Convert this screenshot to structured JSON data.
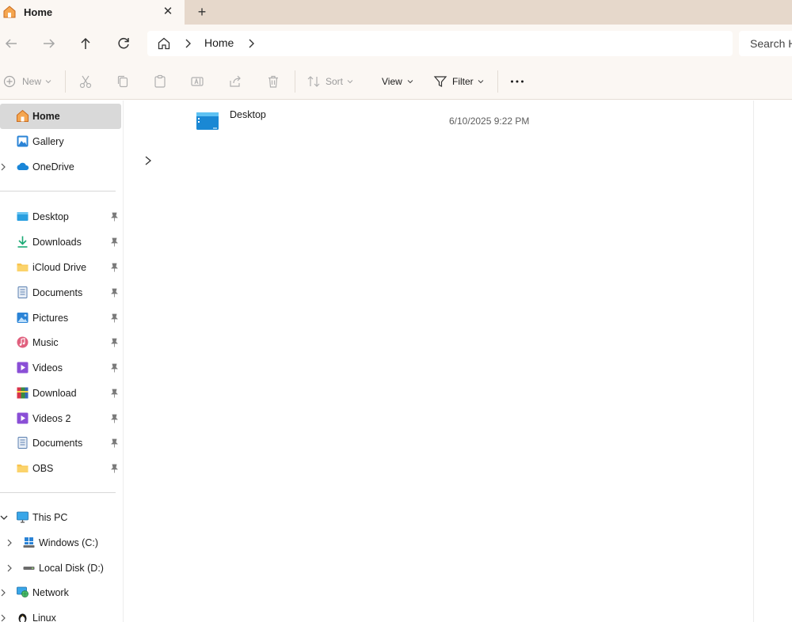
{
  "tab": {
    "title": "Home",
    "close_glyph": "✕",
    "new_glyph": "+"
  },
  "address": {
    "location": "Home",
    "search_placeholder": "Search H"
  },
  "toolbar": {
    "new_label": "New",
    "sort_label": "Sort",
    "view_label": "View",
    "filter_label": "Filter"
  },
  "sidebar": {
    "top": [
      {
        "label": "Home",
        "icon": "home-icon"
      },
      {
        "label": "Gallery",
        "icon": "gallery-icon"
      },
      {
        "label": "OneDrive",
        "icon": "cloud-icon"
      }
    ],
    "pinned": [
      {
        "label": "Desktop",
        "icon": "desktop-folder-icon"
      },
      {
        "label": "Downloads",
        "icon": "download-arrow-icon"
      },
      {
        "label": "iCloud Drive",
        "icon": "folder-icon"
      },
      {
        "label": "Documents",
        "icon": "document-icon"
      },
      {
        "label": "Pictures",
        "icon": "picture-icon"
      },
      {
        "label": "Music",
        "icon": "music-icon"
      },
      {
        "label": "Videos",
        "icon": "video-icon"
      },
      {
        "label": "Download",
        "icon": "winrar-icon"
      },
      {
        "label": "Videos 2",
        "icon": "video-icon"
      },
      {
        "label": "Documents",
        "icon": "document-icon"
      },
      {
        "label": "OBS",
        "icon": "folder-icon"
      }
    ],
    "devices": [
      {
        "label": "This PC",
        "icon": "computer-icon"
      },
      {
        "label": "Windows (C:)",
        "icon": "windows-drive-icon"
      },
      {
        "label": "Local Disk (D:)",
        "icon": "drive-icon"
      },
      {
        "label": "Network",
        "icon": "network-icon"
      },
      {
        "label": "Linux",
        "icon": "linux-penguin-icon"
      }
    ]
  },
  "content": {
    "files": [
      {
        "name": "Desktop",
        "date": "6/10/2025 9:22 PM",
        "icon": "desktop-folder-icon"
      }
    ]
  },
  "colors": {
    "tabbar": "#e6d8cb",
    "chrome": "#fbf7f3",
    "selected": "#d9d9d9",
    "folder": "#f8c44f",
    "accent": "#1a86d8"
  }
}
